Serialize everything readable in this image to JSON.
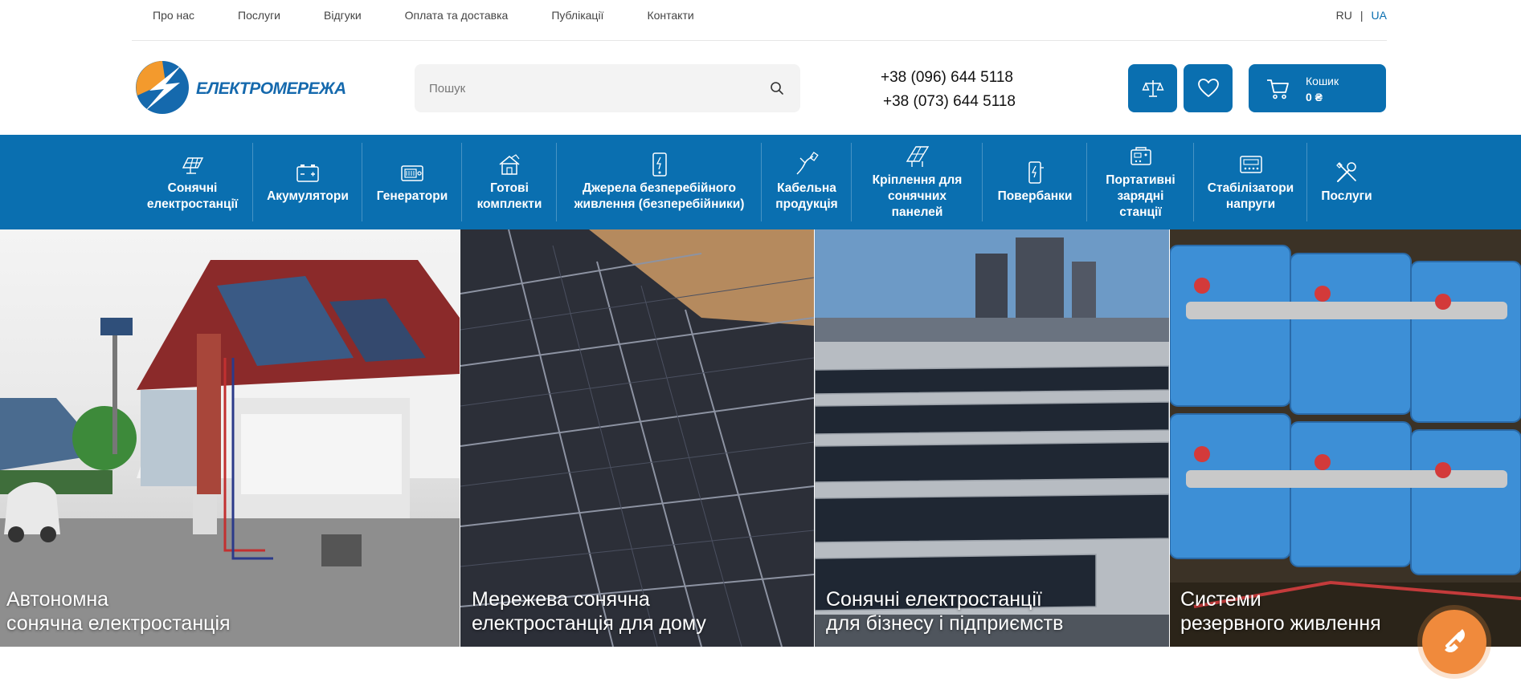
{
  "topnav": {
    "items": [
      "Про нас",
      "Послуги",
      "Відгуки",
      "Оплата та доставка",
      "Публікації",
      "Контакти"
    ],
    "lang_ru": "RU",
    "lang_sep": "|",
    "lang_ua": "UA"
  },
  "header": {
    "logo_text": "ЕЛЕКТРОМЕРЕЖА",
    "search_placeholder": "Пошук",
    "phone_1": "+38 (096) 644 5118",
    "phone_2": "+38 (073) 644 5118",
    "cart_label": "Кошик",
    "cart_sum": "0 ₴"
  },
  "categories": [
    {
      "label": "Сонячні електростанції",
      "icon": "solar-panel-icon"
    },
    {
      "label": "Акумулятори",
      "icon": "battery-icon"
    },
    {
      "label": "Генератори",
      "icon": "generator-icon"
    },
    {
      "label": "Готові комплекти",
      "icon": "house-kit-icon"
    },
    {
      "label": "Джерела безперебійного живлення (безперебійники)",
      "icon": "ups-icon"
    },
    {
      "label": "Кабельна продукція",
      "icon": "cable-icon"
    },
    {
      "label": "Кріплення для сонячних панелей",
      "icon": "mount-icon"
    },
    {
      "label": "Повербанки",
      "icon": "powerbank-icon"
    },
    {
      "label": "Портативні зарядні станції",
      "icon": "portable-station-icon"
    },
    {
      "label": "Стабілізатори напруги",
      "icon": "stabilizer-icon"
    },
    {
      "label": "Послуги",
      "icon": "tools-icon"
    }
  ],
  "banners": [
    {
      "line1": "Автономна",
      "line2": "сонячна електростанція"
    },
    {
      "line1": "Мережева сонячна",
      "line2": "електростанція для дому"
    },
    {
      "line1": "Сонячні електростанції",
      "line2": "для бізнесу і підприємств"
    },
    {
      "line1": "Системи",
      "line2": "резервного живлення"
    }
  ],
  "colors": {
    "brand_blue": "#0a6fb0",
    "accent_orange": "#f08a3c"
  }
}
